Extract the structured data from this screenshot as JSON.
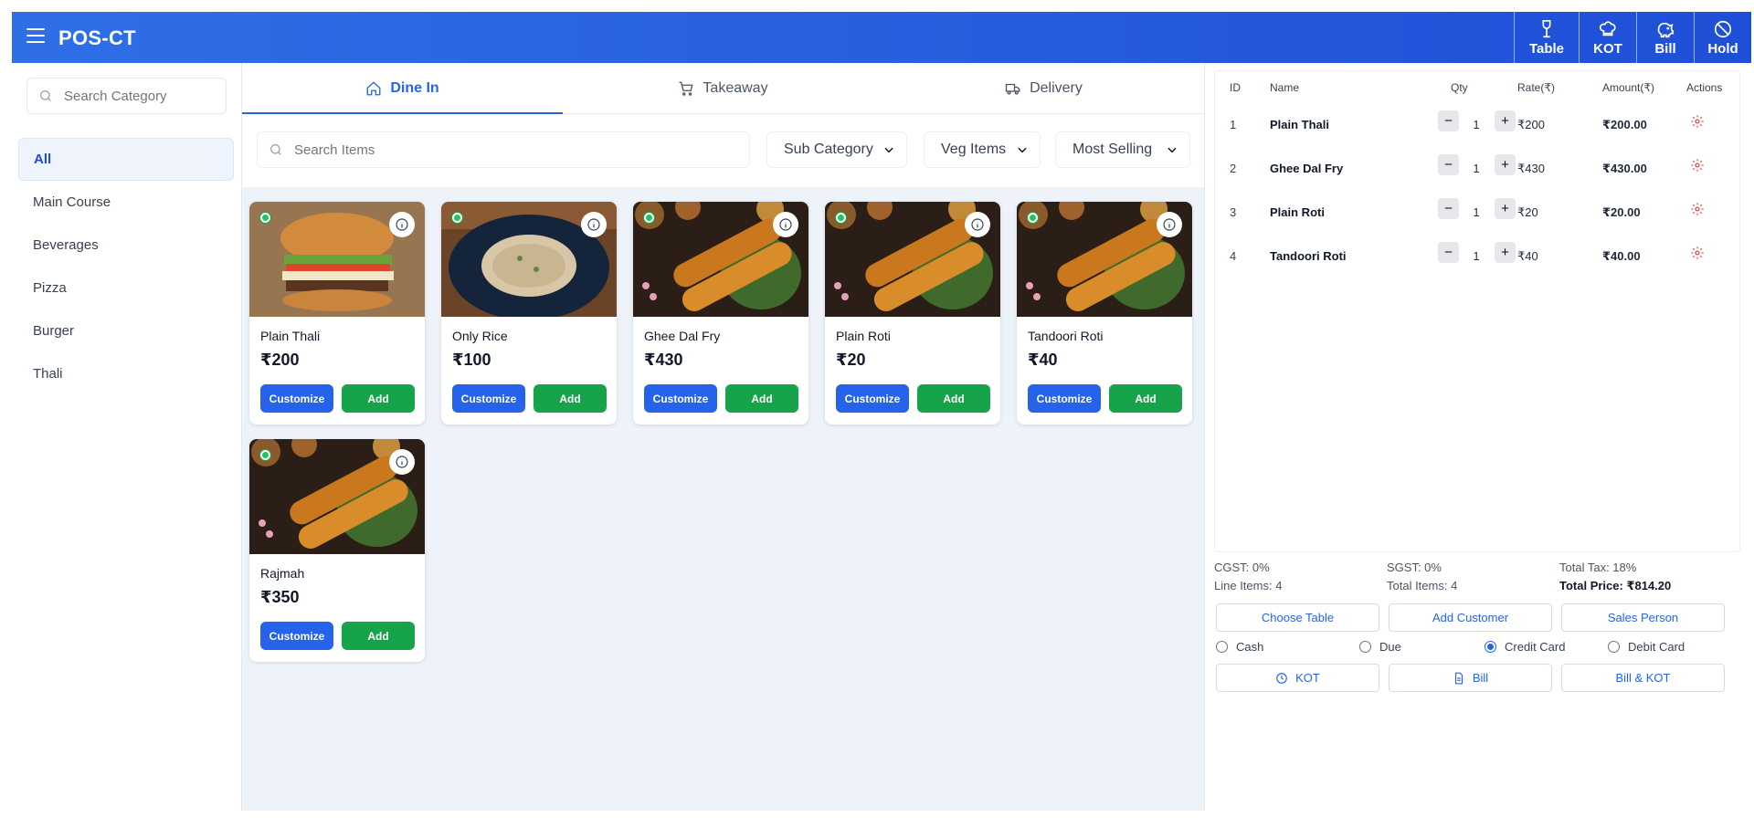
{
  "header": {
    "brand": "POS-CT",
    "buttons": [
      {
        "label": "Table",
        "icon": "wine-glass-icon"
      },
      {
        "label": "KOT",
        "icon": "chef-hat-icon"
      },
      {
        "label": "Bill",
        "icon": "piggy-bank-icon"
      },
      {
        "label": "Hold",
        "icon": "ban-icon"
      }
    ]
  },
  "sidebar": {
    "search_placeholder": "Search Category",
    "categories": [
      "All",
      "Main Course",
      "Beverages",
      "Pizza",
      "Burger",
      "Thali"
    ],
    "active": "All"
  },
  "tabs": [
    {
      "label": "Dine In",
      "active": true
    },
    {
      "label": "Takeaway",
      "active": false
    },
    {
      "label": "Delivery",
      "active": false
    }
  ],
  "toolbar": {
    "search_placeholder": "Search Items",
    "sub_category": "Sub Category",
    "veg_filter": "Veg Items",
    "sort": "Most Selling"
  },
  "items": [
    {
      "name": "Plain Thali",
      "price": "₹200",
      "image": "burger"
    },
    {
      "name": "Only Rice",
      "price": "₹100",
      "image": "rice"
    },
    {
      "name": "Ghee Dal Fry",
      "price": "₹430",
      "image": "dosa"
    },
    {
      "name": "Plain Roti",
      "price": "₹20",
      "image": "dosa"
    },
    {
      "name": "Tandoori Roti",
      "price": "₹40",
      "image": "dosa"
    },
    {
      "name": "Rajmah",
      "price": "₹350",
      "image": "dosa"
    }
  ],
  "item_buttons": {
    "customize": "Customize",
    "add": "Add"
  },
  "order": {
    "columns": {
      "id": "ID",
      "name": "Name",
      "qty": "Qty",
      "rate": "Rate(₹)",
      "amount": "Amount(₹)",
      "actions": "Actions"
    },
    "rows": [
      {
        "id": "1",
        "name": "Plain Thali",
        "qty": "1",
        "rate": "₹200",
        "amount": "₹200.00"
      },
      {
        "id": "2",
        "name": "Ghee Dal Fry",
        "qty": "1",
        "rate": "₹430",
        "amount": "₹430.00"
      },
      {
        "id": "3",
        "name": "Plain Roti",
        "qty": "1",
        "rate": "₹20",
        "amount": "₹20.00"
      },
      {
        "id": "4",
        "name": "Tandoori Roti",
        "qty": "1",
        "rate": "₹40",
        "amount": "₹40.00"
      }
    ]
  },
  "summary": {
    "cgst": "CGST: 0%",
    "sgst": "SGST: 0%",
    "total_tax": "Total Tax: 18%",
    "line_items": "Line Items: 4",
    "total_items": "Total Items: 4",
    "total_price": "Total Price: ₹814.20"
  },
  "actions": {
    "choose_table": "Choose Table",
    "add_customer": "Add Customer",
    "sales_person": "Sales Person"
  },
  "payment": {
    "options": [
      "Cash",
      "Due",
      "Credit Card",
      "Debit Card"
    ],
    "selected": "Credit Card"
  },
  "submit": {
    "kot": "KOT",
    "bill": "Bill",
    "bill_kot": "Bill & KOT"
  },
  "colors": {
    "primary": "#2563eb",
    "header": "#2f6fe6",
    "success": "#16a34a",
    "danger": "#dc2626"
  }
}
